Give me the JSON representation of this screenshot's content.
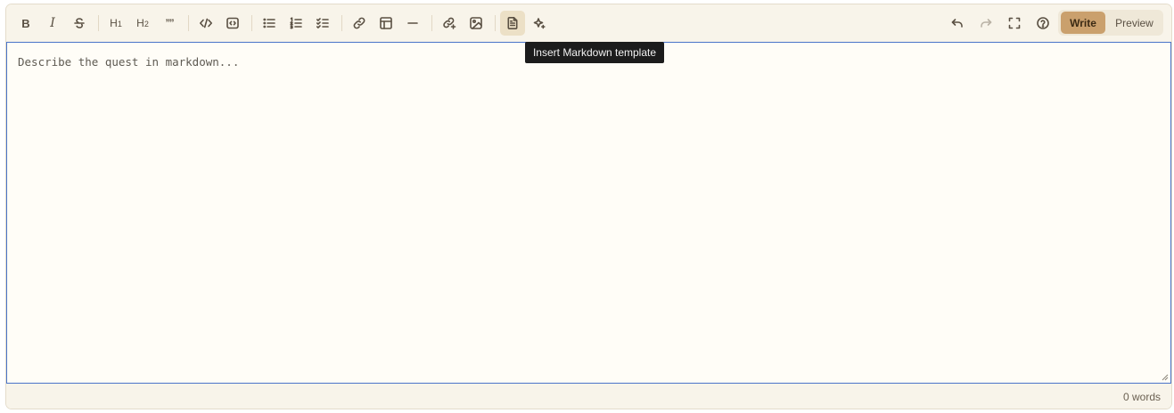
{
  "toolbar": {
    "bold_label": "B",
    "italic_label": "I",
    "h1_label": "H",
    "h1_sub": "1",
    "h2_label": "H",
    "h2_sub": "2",
    "quote_label": "””",
    "write_label": "Write",
    "preview_label": "Preview"
  },
  "editor": {
    "placeholder": "Describe the quest in markdown..."
  },
  "tooltip": {
    "text": "Insert Markdown template"
  },
  "footer": {
    "word_count": "0 words"
  },
  "colors": {
    "accent": "#caa06d",
    "focus_border": "#4a74c9",
    "background": "#fdfbf5"
  }
}
